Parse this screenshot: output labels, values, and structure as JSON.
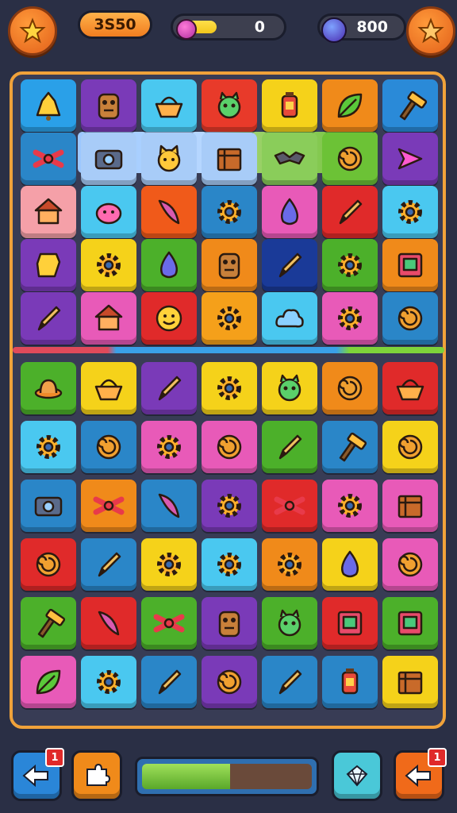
{
  "hud": {
    "score": "3S50",
    "energy_value": "0",
    "energy_fill": 0.35,
    "coins": "800"
  },
  "board": {
    "border_color": "#f0a23a",
    "top_grid": [
      [
        [
          "#2aa0e8",
          "bell"
        ],
        [
          "#7a3ab8",
          "totem"
        ],
        [
          "#4ac8f0",
          "basket"
        ],
        [
          "#e83a2a",
          "creature"
        ],
        [
          "#f5d21a",
          "lantern"
        ],
        [
          "#f08a1a",
          "leaf"
        ],
        [
          "#2a8ad8",
          "hammer"
        ]
      ],
      [
        [
          "#2a86c8",
          "ribbon"
        ],
        [
          "#a8ccf8",
          "camera"
        ],
        [
          "#a8ccf8",
          "cat"
        ],
        [
          "#a8ccf8",
          "crate"
        ],
        [
          "#8acd5a",
          "bat"
        ],
        [
          "#6cc236",
          "shell"
        ],
        [
          "#7a3ab8",
          "arrow"
        ]
      ],
      [
        [
          "#f5a0a8",
          "hut"
        ],
        [
          "#4ac8f0",
          "blob"
        ],
        [
          "#f05a1a",
          "wing"
        ],
        [
          "#2a86c8",
          "gear"
        ],
        [
          "#e85ab8",
          "drop"
        ],
        [
          "#e02a2a",
          "pen"
        ],
        [
          "#4ac8f0",
          "gear"
        ]
      ],
      [
        [
          "#7a3ab8",
          "block"
        ],
        [
          "#f5d21a",
          "gear"
        ],
        [
          "#4cb02a",
          "drop"
        ],
        [
          "#f08a1a",
          "totem"
        ],
        [
          "#1a3a98",
          "pen"
        ],
        [
          "#4cb02a",
          "gear"
        ],
        [
          "#f08a1a",
          "book"
        ]
      ],
      [
        [
          "#7a3ab8",
          "pen"
        ],
        [
          "#e85ab8",
          "hut"
        ],
        [
          "#e02a2a",
          "smile"
        ],
        [
          "#f5a01a",
          "gear"
        ],
        [
          "#4ac8f0",
          "cloud"
        ],
        [
          "#e85ab8",
          "gear"
        ],
        [
          "#2a86c8",
          "shell"
        ]
      ]
    ],
    "bottom_grid": [
      [
        [
          "#4cb02a",
          "hat"
        ],
        [
          "#f5d21a",
          "basket"
        ],
        [
          "#7a3ab8",
          "pen"
        ],
        [
          "#f5d21a",
          "gear"
        ],
        [
          "#f5d21a",
          "creature"
        ],
        [
          "#f08a1a",
          "shell"
        ],
        [
          "#e02a2a",
          "basket"
        ]
      ],
      [
        [
          "#4ac8f0",
          "gear"
        ],
        [
          "#2a86c8",
          "shell"
        ],
        [
          "#e85ab8",
          "gear"
        ],
        [
          "#e85ab8",
          "shell"
        ],
        [
          "#4cb02a",
          "pen"
        ],
        [
          "#2a86c8",
          "hammer"
        ],
        [
          "#f5d21a",
          "shell"
        ]
      ],
      [
        [
          "#2a86c8",
          "camera"
        ],
        [
          "#f08a1a",
          "ribbon"
        ],
        [
          "#2a86c8",
          "wing"
        ],
        [
          "#7a3ab8",
          "gear"
        ],
        [
          "#e02a2a",
          "ribbon"
        ],
        [
          "#e85ab8",
          "gear"
        ],
        [
          "#e85ab8",
          "crate"
        ]
      ],
      [
        [
          "#e02a2a",
          "shell"
        ],
        [
          "#2a86c8",
          "pen"
        ],
        [
          "#f5d21a",
          "gear"
        ],
        [
          "#4ac8f0",
          "gear"
        ],
        [
          "#f08a1a",
          "gear"
        ],
        [
          "#f5d21a",
          "drop"
        ],
        [
          "#e85ab8",
          "shell"
        ]
      ],
      [
        [
          "#4cb02a",
          "hammer"
        ],
        [
          "#e02a2a",
          "wing"
        ],
        [
          "#4cb02a",
          "ribbon"
        ],
        [
          "#7a3ab8",
          "totem"
        ],
        [
          "#4cb02a",
          "creature"
        ],
        [
          "#e02a2a",
          "book"
        ],
        [
          "#4cb02a",
          "book"
        ]
      ],
      [
        [
          "#e85ab8",
          "leaf"
        ],
        [
          "#4ac8f0",
          "gear"
        ],
        [
          "#2a86c8",
          "pen"
        ],
        [
          "#7a3ab8",
          "shell"
        ],
        [
          "#2a86c8",
          "pen"
        ],
        [
          "#2a86c8",
          "lantern"
        ],
        [
          "#f5d21a",
          "crate"
        ]
      ]
    ]
  },
  "footer": {
    "back_badge": "1",
    "share_badge": "1",
    "level_progress": 0.52
  }
}
